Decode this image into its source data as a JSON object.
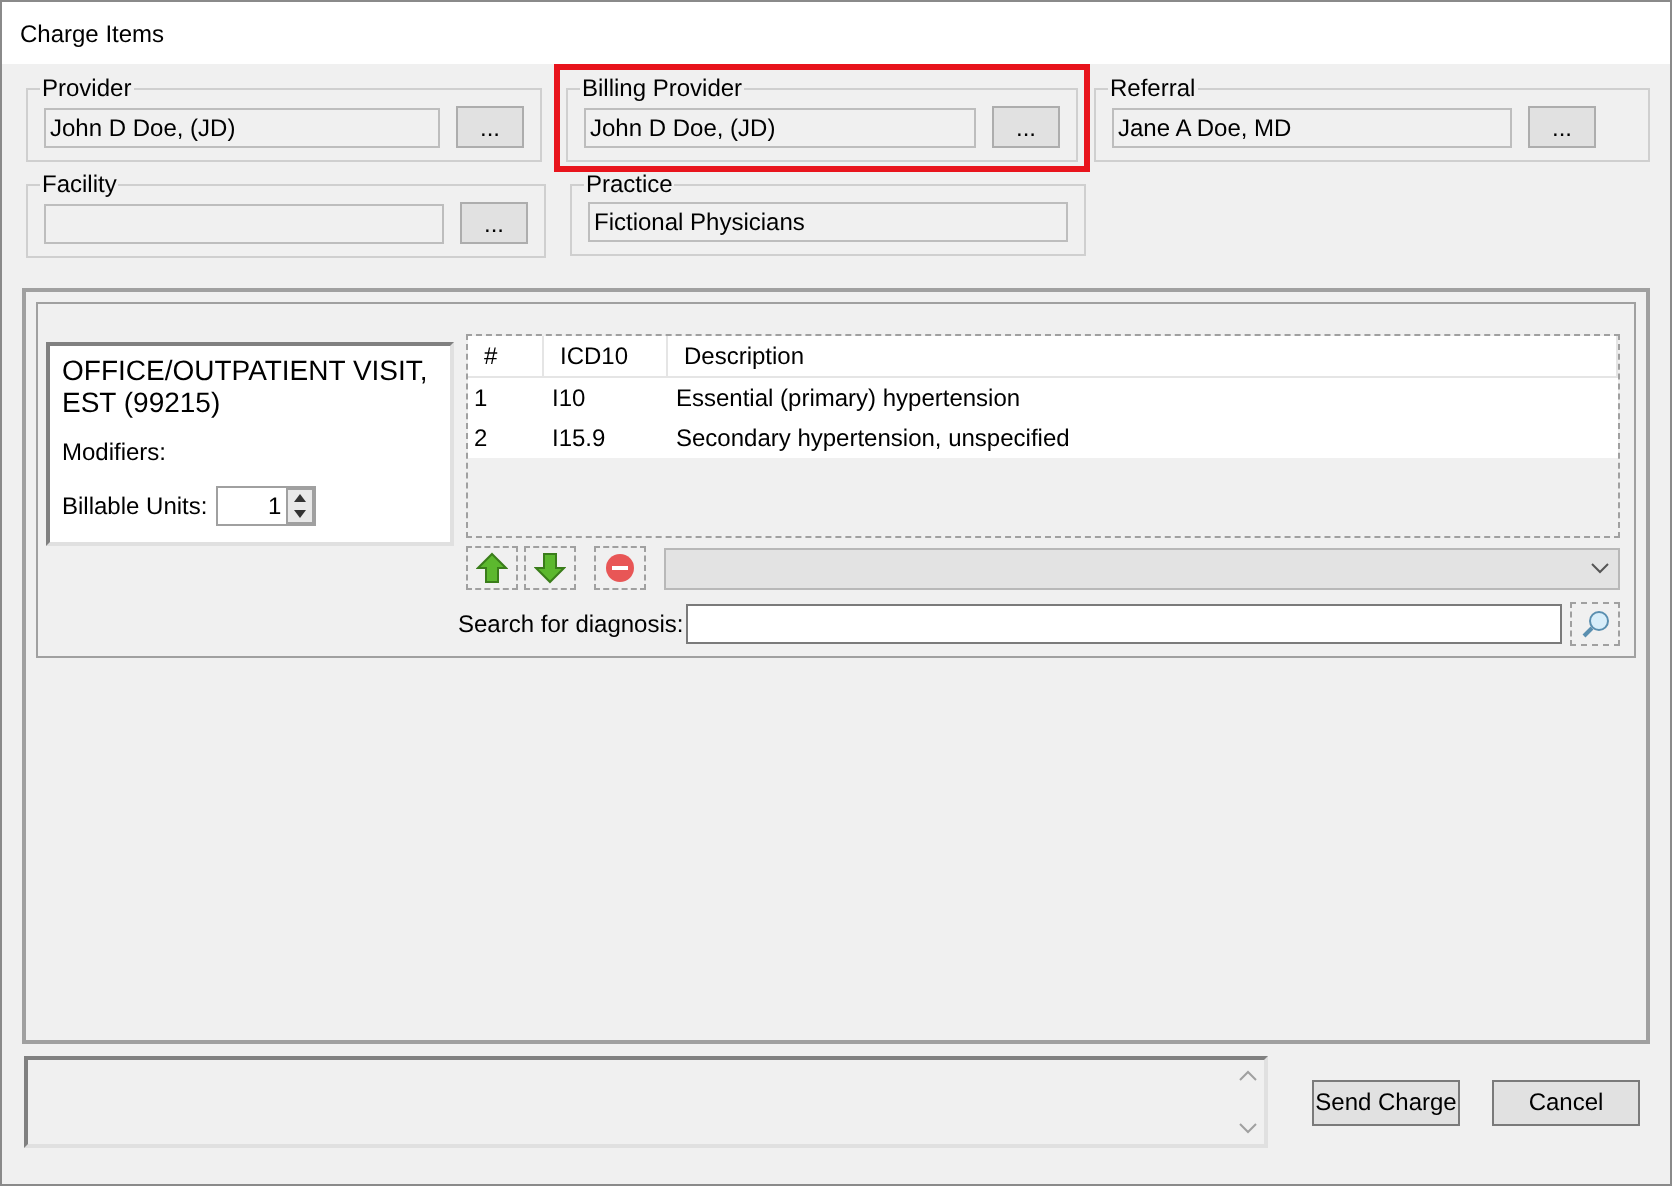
{
  "window": {
    "title": "Charge Items"
  },
  "top_groups": [
    {
      "label": "Provider",
      "value": "John D Doe, (JD)",
      "button": "...",
      "highlighted": false
    },
    {
      "label": "Billing Provider",
      "value": "John D Doe, (JD)",
      "button": "...",
      "highlighted": true
    },
    {
      "label": "Referral",
      "value": "Jane A Doe, MD",
      "button": "...",
      "highlighted": false
    }
  ],
  "second_groups": [
    {
      "label": "Facility",
      "button": "..."
    },
    {
      "label": "Practice",
      "value": "Fictional Physicians"
    }
  ],
  "procedure": {
    "title": "OFFICE/OUTPATIENT VISIT, EST (99215)",
    "modifiers_label": "Modifiers:",
    "units_label": "Billable Units:",
    "units_value": "1"
  },
  "diagnoses": {
    "columns": [
      "#",
      "ICD10",
      "Description"
    ],
    "rows": [
      [
        "1",
        "I10",
        "Essential (primary) hypertension"
      ],
      [
        "2",
        "I15.9",
        "Secondary hypertension, unspecified"
      ]
    ]
  },
  "search": {
    "label": "Search for diagnosis:"
  },
  "buttons": [
    "Send Charge",
    "Cancel"
  ]
}
